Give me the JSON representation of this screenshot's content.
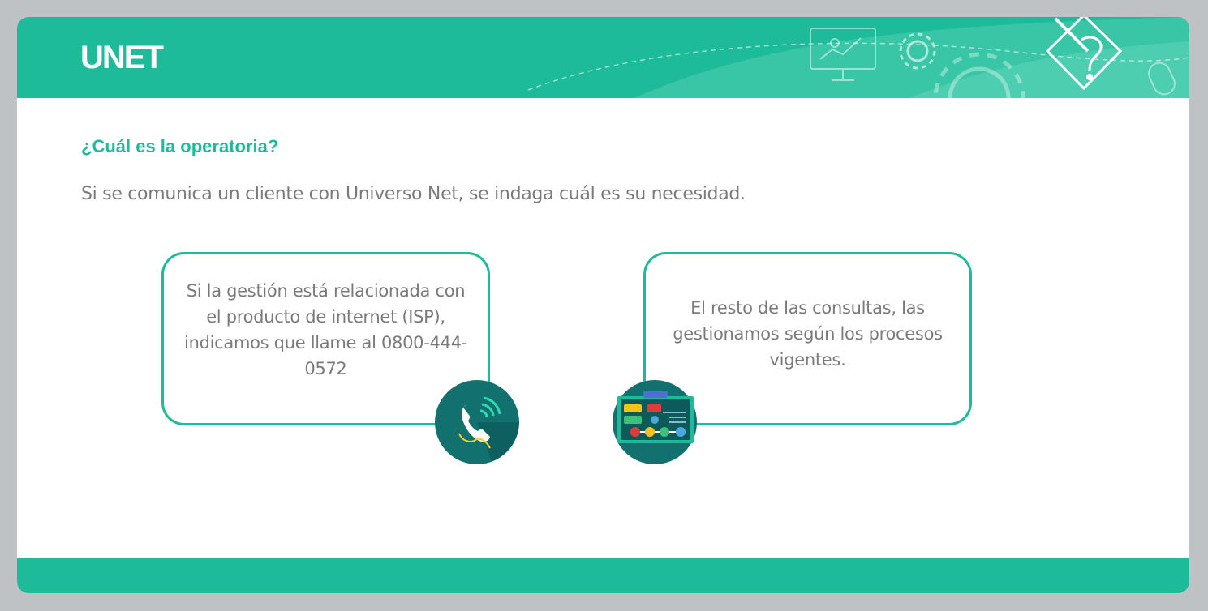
{
  "header": {
    "logo": "UNET"
  },
  "content": {
    "heading": "¿Cuál es la operatoria?",
    "intro": "Si se comunica un cliente con Universo Net, se indaga cuál es su necesidad.",
    "boxes": [
      {
        "text": "Si la gestión está relacionada con el producto de internet (ISP), indicamos que llame al 0800-444-0572",
        "icon": "phone-icon"
      },
      {
        "text": "El resto de las consultas, las gestionamos según los procesos vigentes.",
        "icon": "process-board-icon"
      }
    ]
  },
  "colors": {
    "accent": "#1dbb99",
    "dark_teal": "#0f6b6b",
    "text_gray": "#7a7a7a",
    "background": "#bfc2c5"
  }
}
